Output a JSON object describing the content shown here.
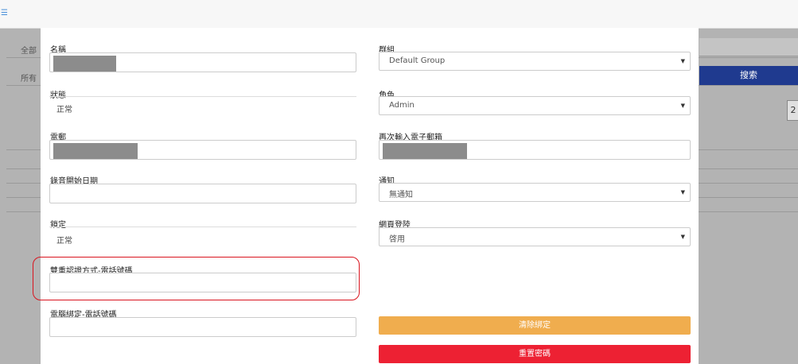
{
  "background": {
    "filter_all": "全部",
    "filter_owner": "所有",
    "search_label": "搜索",
    "refresh_glyph": "2"
  },
  "form": {
    "name": {
      "label": "名稱"
    },
    "group": {
      "label": "群組",
      "value": "Default Group"
    },
    "status": {
      "label": "狀態",
      "value": "正常"
    },
    "role": {
      "label": "角色",
      "value": "Admin"
    },
    "email": {
      "label": "電郵"
    },
    "email_confirm": {
      "label": "再次輸入電子郵箱"
    },
    "record_start": {
      "label": "錄音開始日期"
    },
    "notify": {
      "label": "通知",
      "value": "無通知"
    },
    "lock": {
      "label": "鎖定",
      "value": "正常"
    },
    "web_login": {
      "label": "網頁登陸",
      "value": "啓用"
    },
    "two_factor_phone": {
      "label": "雙重認證方式-電話號碼"
    },
    "pc_bind_phone": {
      "label": "電腦綁定-電話號碼"
    },
    "unbind_button": "清除綁定",
    "reset_password_button": "重置密碼"
  }
}
